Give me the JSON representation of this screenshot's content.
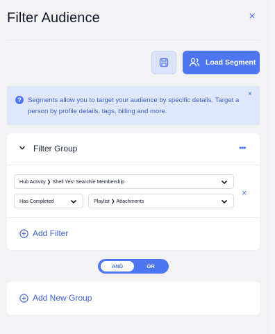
{
  "header": {
    "title": "Filter Audience",
    "close_icon": "×"
  },
  "toolbar": {
    "load_label": "Load Segment"
  },
  "info": {
    "text": "Segments allow you to target your audience by specific details. Target a person by profile details, tags, billing and more.",
    "close_icon": "×"
  },
  "group": {
    "title": "Filter Group",
    "menu_icon": "•••",
    "filter": {
      "property_value": "Hub Activity  ❯  Shell Yes! Searchie Membership",
      "condition_value": "Has Completed",
      "target_value": "Playlist  ❯  Attachments",
      "remove_icon": "×"
    },
    "add_filter_label": "Add Filter"
  },
  "toggle": {
    "and_label": "AND",
    "or_label": "OR",
    "selected": "AND"
  },
  "add_group_label": "Add New Group",
  "colors": {
    "accent": "#4e76f3",
    "info_bg": "#dfe7fb",
    "panel_bg": "#f3f3f5"
  }
}
